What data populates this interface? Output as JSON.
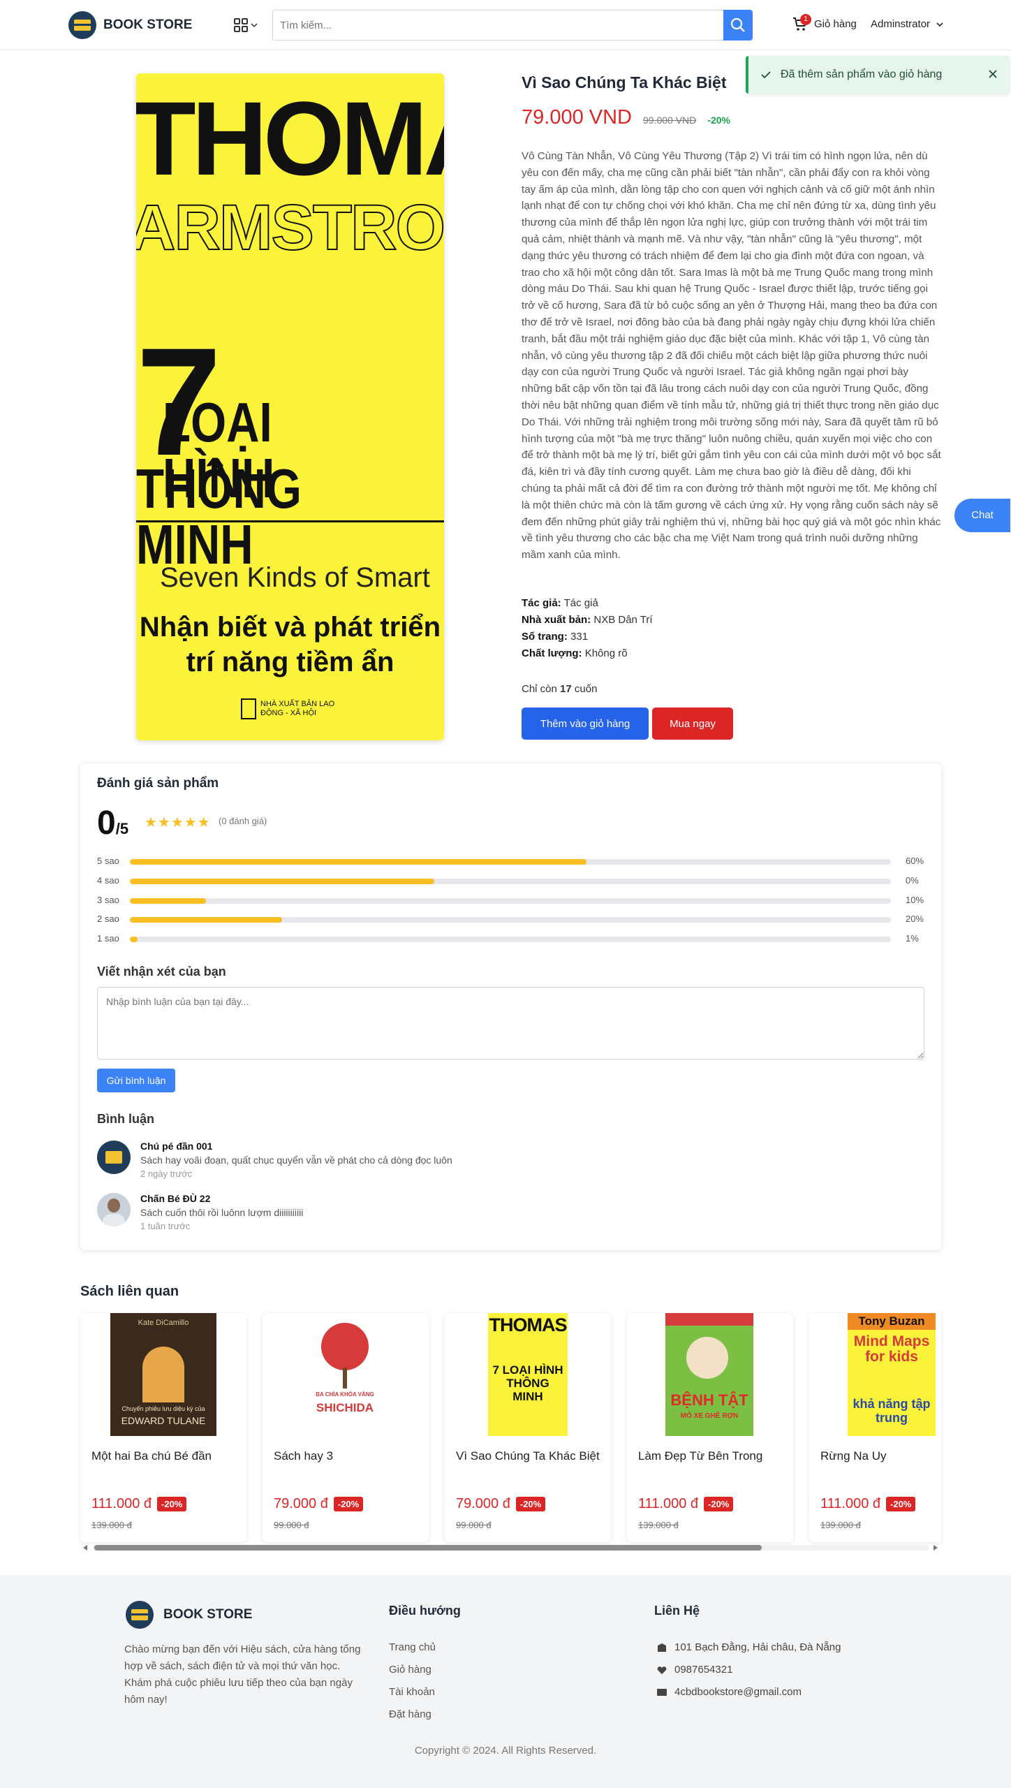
{
  "header": {
    "brand": "BOOK STORE",
    "search_placeholder": "Tìm kiếm...",
    "cart_label": "Giỏ hàng",
    "cart_count": "1",
    "user_label": "Adminstrator"
  },
  "toast": {
    "message": "Đã thêm sản phẩm vào giỏ hàng"
  },
  "cover": {
    "line1": "THOMAS",
    "line2": "ARMSTRONG",
    "line3": "7",
    "line4": "LOẠI HÌNH",
    "line5": "THÔNG MINH",
    "line6": "Seven Kinds of Smart",
    "line7": "Nhận biết và phát triển",
    "line8": "trí năng tiềm ẩn",
    "publisher": "NHÀ XUẤT BẢN LAO ĐỘNG - XÃ HỘI"
  },
  "product": {
    "title": "Vì Sao Chúng Ta Khác Biệt",
    "price": "79.000 VND",
    "old_price": "99.000 VND",
    "discount": "-20%",
    "description": "Vô Cùng Tàn Nhẫn, Vô Cùng Yêu Thương (Tập 2) Vì trái tim có hình ngọn lửa, nên dù yêu con đến mấy, cha mẹ cũng cần phải biết \"tàn nhẫn\", cần phải đẩy con ra khỏi vòng tay ấm áp của mình, dằn lòng tập cho con quen với nghịch cảnh và cố giữ một ánh nhìn lạnh nhạt để con tự chống chọi với khó khăn. Cha mẹ chỉ nên đứng từ xa, dùng tình yêu thương của mình để thắp lên ngọn lửa nghị lực, giúp con trưởng thành với một trái tim quả cảm, nhiệt thành và mạnh mẽ. Và như vậy, \"tàn nhẫn\" cũng là \"yêu thương\", một dạng thức yêu thương có trách nhiệm để đem lại cho gia đình một đứa con ngoan, và trao cho xã hội một công dân tốt. Sara Imas là một bà mẹ Trung Quốc mang trong mình dòng máu Do Thái. Sau khi quan hệ Trung Quốc - Israel được thiết lập, trước tiếng gọi trở về cố hương, Sara đã từ bỏ cuộc sống an yên ở Thượng Hải, mang theo ba đứa con thơ để trở về Israel, nơi đông bào của bà đang phải ngày ngày chịu đựng khói lửa chiến tranh, bắt đầu một trải nghiệm giáo dục đặc biệt của mình. Khác với tập 1, Vô cùng tàn nhẫn, vô cùng yêu thương tập 2 đã đối chiếu một cách biệt lập giữa phương thức nuôi dạy con của người Trung Quốc và người Israel. Tác giả không ngần ngại phơi bày những bất cập vốn tồn tại đã lâu trong cách nuôi dạy con của người Trung Quốc, đồng thời nêu bật những quan điểm về tính mẫu tử, những giá trị thiết thực trong nền giáo dục Do Thái. Với những trải nghiệm trong môi trường sống mới này, Sara đã quyết tâm rũ bỏ hình tượng của một \"bà mẹ trực thăng\" luôn nuông chiều, quán xuyến mọi việc cho con để trở thành một bà mẹ lý trí, biết gửi gắm tình yêu con cái của mình dưới một vỏ bọc sắt đá, kiên trì và đầy tính cương quyết. Làm mẹ chưa bao giờ là điều dễ dàng, đối khi chúng ta phải mất cả đời để tìm ra con đường trở thành một người mẹ tốt. Mẹ không chỉ là một thiên chức mà còn là tấm gương về cách ứng xử. Hy vọng rằng cuốn sách này sẽ đem đến những phút giây trải nghiệm thú vị, những bài học quý giá và một góc nhìn khác về tình yêu thương cho các bậc cha mẹ Việt Nam trong quá trình nuôi dưỡng những mầm xanh của mình.",
    "author_label": "Tác giả:",
    "author": "Tác giả",
    "publisher_label": "Nhà xuất bản:",
    "publisher": "NXB Dân Trí",
    "pages_label": "Số trang:",
    "pages": "331",
    "quality_label": "Chất lượng:",
    "quality": "Không rõ",
    "stock_prefix": "Chỉ còn",
    "stock_qty": "17",
    "stock_suffix": "cuốn",
    "add_to_cart": "Thêm vào giỏ hàng",
    "buy_now": "Mua ngay"
  },
  "chat_label": "Chat",
  "reviews": {
    "title": "Đánh giá sản phẩm",
    "score": "0",
    "score_max": "/5",
    "stars": "★★★★★",
    "count": "(0 đánh giá)",
    "bars": [
      {
        "label": "5 sao",
        "pct_text": "60%",
        "fill": 0.6
      },
      {
        "label": "4 sao",
        "pct_text": "0%",
        "fill": 0.4
      },
      {
        "label": "3 sao",
        "pct_text": "10%",
        "fill": 0.1
      },
      {
        "label": "2 sao",
        "pct_text": "20%",
        "fill": 0.2
      },
      {
        "label": "1 sao",
        "pct_text": "1%",
        "fill": 0.01
      }
    ],
    "write_title": "Viết nhận xét của bạn",
    "write_placeholder": "Nhập bình luận của bạn tại đây...",
    "send_label": "Gửi bình luận",
    "comments_title": "Bình luận",
    "comments": [
      {
        "name": "Chú pé đần 001",
        "text": "Sách hay voãi đoạn, quất chục quyển vẫn về phát cho cả dòng đọc luôn",
        "time": "2 ngày trước"
      },
      {
        "name": "Chấn Bé ĐÙ 22",
        "text": "Sách cuốn thôi rồi luônn lượm diiiiiiiiiii",
        "time": "1 tuần trước"
      }
    ]
  },
  "related": {
    "title": "Sách liên quan",
    "items": [
      {
        "name": "Một hai Ba chú Bé đần",
        "price": "111.000 đ",
        "discount": "-20%",
        "old_price": "139.000 đ"
      },
      {
        "name": "Sách hay 3",
        "price": "79.000 đ",
        "discount": "-20%",
        "old_price": "99.000 đ"
      },
      {
        "name": "Vì Sao Chúng Ta Khác Biệt",
        "price": "79.000 đ",
        "discount": "-20%",
        "old_price": "99.000 đ"
      },
      {
        "name": "Làm Đẹp Từ Bên Trong",
        "price": "111.000 đ",
        "discount": "-20%",
        "old_price": "139.000 đ"
      },
      {
        "name": "Rừng Na Uy",
        "price": "111.000 đ",
        "discount": "-20%",
        "old_price": "139.000 đ"
      }
    ],
    "thumb_texts": {
      "t1_author": "Kate DiCamillo",
      "t1_sub": "Chuyến phiêu lưu diệu kỳ của",
      "t1_title": "EDWARD TULANE",
      "t2_top": "BA CHÌA KHÓA VÀNG",
      "t2_title": "SHICHIDA",
      "t3_title": "THOMAS",
      "t3_sub": "7 LOẠI HÌNH THÔNG MINH",
      "t4_title": "BỆNH TẬT",
      "t4_sub": "MỎ XE GHÊ RỢN",
      "t5_author": "Tony Buzan",
      "t5_title": "Mind Maps for kids",
      "t5_sub": "khả năng tập trung"
    }
  },
  "footer": {
    "brand": "BOOK STORE",
    "about": "Chào mừng bạn đến với Hiệu sách, cửa hàng tổng hợp về sách, sách điện tử và mọi thứ văn học. Khám phá cuộc phiêu lưu tiếp theo của bạn ngày hôm nay!",
    "nav_title": "Điều hướng",
    "nav": [
      "Trang chủ",
      "Giỏ hàng",
      "Tài khoản",
      "Đặt hàng"
    ],
    "contact_title": "Liên Hệ",
    "address": "101 Bạch Đằng, Hải châu, Đà Nẵng",
    "phone": "0987654321",
    "email": "4cbdbookstore@gmail.com",
    "copyright": "Copyright © 2024. All Rights Reserved."
  },
  "colors": {
    "primary": "#2563eb",
    "danger": "#dc2626",
    "success": "#16a34a",
    "star": "#fbbf24",
    "cover_yellow": "#fbf33a"
  }
}
